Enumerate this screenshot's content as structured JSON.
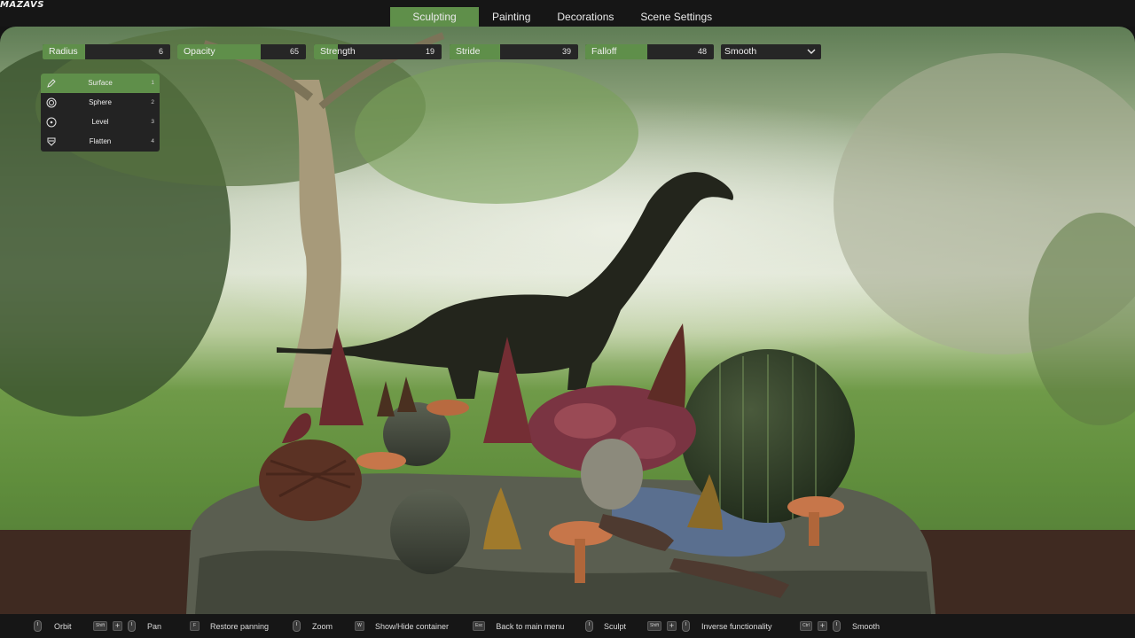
{
  "app": {
    "logo": "MAZAVS"
  },
  "tabs": [
    {
      "label": "Sculpting",
      "active": true
    },
    {
      "label": "Painting"
    },
    {
      "label": "Decorations"
    },
    {
      "label": "Scene Settings"
    }
  ],
  "params": {
    "radius": {
      "label": "Radius",
      "value": "6",
      "fill_fraction": 0.33
    },
    "opacity": {
      "label": "Opacity",
      "value": "65",
      "fill_fraction": 0.65
    },
    "strength": {
      "label": "Strength",
      "value": "19",
      "fill_fraction": 0.19
    },
    "stride": {
      "label": "Stride",
      "value": "39",
      "fill_fraction": 0.39
    },
    "falloff": {
      "label": "Falloff",
      "value": "48",
      "fill_fraction": 0.48
    }
  },
  "mode_select": {
    "value": "Smooth"
  },
  "tools": [
    {
      "label": "Surface",
      "key": "1",
      "icon": "brush-icon",
      "active": true
    },
    {
      "label": "Sphere",
      "key": "2",
      "icon": "sphere-icon"
    },
    {
      "label": "Level",
      "key": "3",
      "icon": "level-icon"
    },
    {
      "label": "Flatten",
      "key": "4",
      "icon": "flatten-icon"
    }
  ],
  "hints": [
    {
      "action": "Orbit",
      "keys": [
        "mouse-left-icon"
      ]
    },
    {
      "action": "Pan",
      "keys": [
        "Shift",
        "+",
        "mouse-left-icon"
      ]
    },
    {
      "action": "Restore panning",
      "keys": [
        "F"
      ]
    },
    {
      "action": "Zoom",
      "keys": [
        "mouse-wheel-icon"
      ]
    },
    {
      "action": "Show/Hide container",
      "keys": [
        "W"
      ]
    },
    {
      "action": "Back to main menu",
      "keys": [
        "Esc"
      ]
    },
    {
      "action": "Sculpt",
      "keys": [
        "mouse-left-icon"
      ]
    },
    {
      "action": "Inverse functionality",
      "keys": [
        "Shift",
        "+",
        "mouse-left-icon"
      ]
    },
    {
      "action": "Smooth",
      "keys": [
        "Ctrl",
        "+",
        "mouse-left-icon"
      ]
    }
  ],
  "colors": {
    "accent": "#5f8f4a",
    "panel": "#262626",
    "bar": "#161616"
  }
}
